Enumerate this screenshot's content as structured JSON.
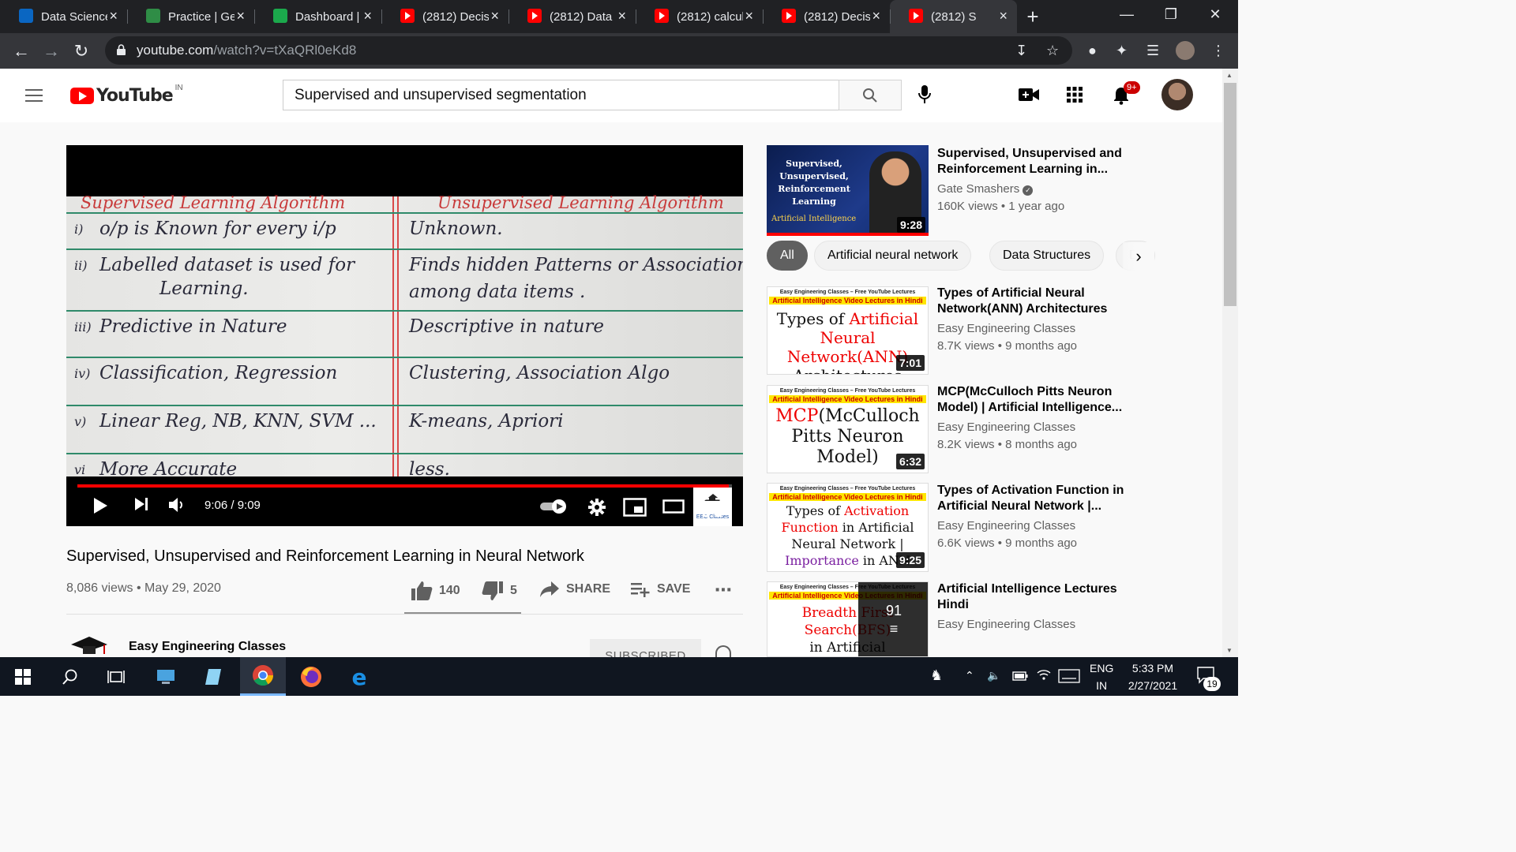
{
  "browser": {
    "tabs": [
      {
        "title": "Data Science",
        "favicon": "linkedin-icon",
        "color": "#0a66c2"
      },
      {
        "title": "Practice | Ge",
        "favicon": "gfg-icon",
        "color": "#2f8d46"
      },
      {
        "title": "Dashboard |",
        "favicon": "hackerrank-icon",
        "color": "#1ba94c"
      },
      {
        "title": "(2812) Decisi",
        "favicon": "youtube-icon",
        "color": "#ff0000"
      },
      {
        "title": "(2812) Data S",
        "favicon": "youtube-icon",
        "color": "#ff0000"
      },
      {
        "title": "(2812) calcul",
        "favicon": "youtube-icon",
        "color": "#ff0000"
      },
      {
        "title": "(2812) Decisi",
        "favicon": "youtube-icon",
        "color": "#ff0000"
      },
      {
        "title": "(2812) S",
        "favicon": "youtube-icon",
        "color": "#ff0000",
        "active": true
      }
    ],
    "url_host": "youtube.com",
    "url_path": "/watch?v=tXaQRl0eKd8"
  },
  "youtube": {
    "logo_text": "YouTube",
    "country": "IN",
    "search_value": "Supervised and unsupervised segmentation",
    "notification_count": "9+"
  },
  "video": {
    "board": {
      "left_heading": "Supervised Learning Algorithm",
      "right_heading": "Unsupervised Learning Algorithm",
      "rows": [
        {
          "num": "i)",
          "left": "o/p is Known for every i/p",
          "right": "Unknown."
        },
        {
          "num": "ii)",
          "left": "Labelled dataset is used for",
          "left2": "Learning.",
          "right": "Finds hidden Patterns or Association",
          "right2": "among data items ."
        },
        {
          "num": "iii)",
          "left": "Predictive in Nature",
          "right": "Descriptive in nature"
        },
        {
          "num": "iv)",
          "left": "Classification, Regression",
          "right": "Clustering, Association Algo"
        },
        {
          "num": "v)",
          "left": "Linear Reg, NB, KNN, SVM ...",
          "right": "K-means, Apriori"
        },
        {
          "num": "vi",
          "left": "More Accurate",
          "right": "less."
        }
      ],
      "watermark": "EEC Classes"
    },
    "progress": 0.995,
    "time": "9:06 / 9:09",
    "title": "Supervised, Unsupervised and Reinforcement Learning in Neural Network",
    "views": "8,086 views",
    "date": "May 29, 2020",
    "likes": "140",
    "dislikes": "5",
    "share_label": "SHARE",
    "save_label": "SAVE",
    "channel": "Easy Engineering Classes",
    "subscribe_label": "SUBSCRIBED"
  },
  "sidebar": {
    "chips": [
      "All",
      "Artificial neural network",
      "Data Structures",
      "Dyk"
    ],
    "items": [
      {
        "title": "Supervised, Unsupervised and Reinforcement Learning in...",
        "channel": "Gate Smashers",
        "verified": true,
        "meta": "160K views • 1 year ago",
        "duration": "9:28",
        "thumb_lines": [
          "Supervised,",
          "Unsupervised,",
          "Reinforcement",
          "Learning"
        ],
        "thumb_footer": "Artificial Intelligence"
      },
      {
        "title": "Types of Artificial Neural Network(ANN) Architectures",
        "channel": "Easy Engineering Classes",
        "meta": "8.7K views • 9 months ago",
        "duration": "7:01",
        "thumb_lines": [
          "Types of ",
          "Artificial",
          "Neural Network(ANN)",
          "Architectures"
        ]
      },
      {
        "title": "MCP(McCulloch Pitts Neuron Model) | Artificial Intelligence...",
        "channel": "Easy Engineering Classes",
        "meta": "8.2K views • 8 months ago",
        "duration": "6:32",
        "thumb_lines": [
          "MCP",
          "(McCulloch",
          "Pitts Neuron",
          "Model)"
        ]
      },
      {
        "title": "Types of Activation Function in Artificial Neural Network |...",
        "channel": "Easy Engineering Classes",
        "meta": "6.6K views • 9 months ago",
        "duration": "9:25",
        "thumb_lines": [
          "Types of ",
          "Activation",
          "Function",
          " in Artificial",
          "Neural Network |",
          "Importance",
          " in ANN"
        ]
      },
      {
        "title": "Artificial Intelligence Lectures Hindi",
        "channel": "Easy Engineering Classes",
        "playlist_count": "91",
        "thumb_lines": [
          "Breadth First Search(BFS)",
          "in Artificial Intelligence"
        ]
      }
    ],
    "thumb_header": "Easy Engineering Classes – Free YouTube Lectures",
    "thumb_bar": "Artificial Intelligence Video Lectures in Hindi"
  },
  "taskbar": {
    "lang": "ENG",
    "region": "IN",
    "time": "5:33 PM",
    "date": "2/27/2021",
    "notifications": "19"
  }
}
